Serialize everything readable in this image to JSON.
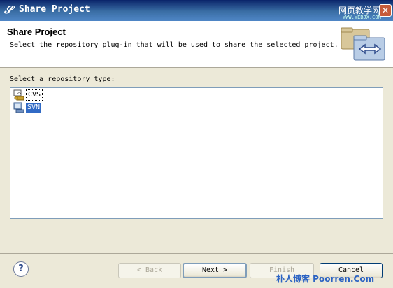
{
  "window": {
    "title": "Share Project",
    "title_icon": "eclipse-icon",
    "close_symbol": "✕"
  },
  "watermark_top": {
    "text": "网页教学网",
    "sub": "WWW.WEBJX.COM"
  },
  "banner": {
    "title": "Share Project",
    "description": "Select the repository plug-in that will be used to share the selected project.",
    "graphic": "wizard-folders-arrows-graphic"
  },
  "repository": {
    "label": "Select a repository type:",
    "items": [
      {
        "label": "CVS",
        "icon": "cvs-repository-icon",
        "selected": false
      },
      {
        "label": "SVN",
        "icon": "svn-repository-icon",
        "selected": true
      }
    ]
  },
  "footer": {
    "help_symbol": "?",
    "back_label": "< Back",
    "next_label": "Next >",
    "finish_label": "Finish",
    "cancel_label": "Cancel"
  },
  "watermark_bottom": {
    "text": "朴人博客 Poorren.Com"
  },
  "colors": {
    "titlebar": "#0a246a",
    "selection": "#316ac5",
    "dialog_bg": "#ece9d8",
    "watermark": "#2b63c3"
  }
}
